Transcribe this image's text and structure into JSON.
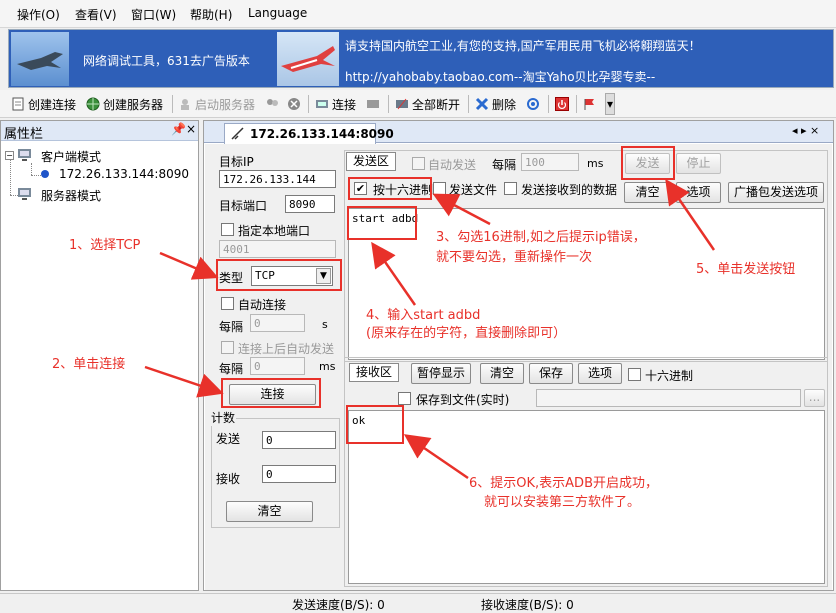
{
  "menu": [
    "操作(O)",
    "查看(V)",
    "窗口(W)",
    "帮助(H)",
    "Language"
  ],
  "banner": {
    "left_text": "网络调试工具，631去广告版本",
    "right_line1": "请支持国内航空工业,有您的支持,国产军用民用飞机必将翱翔蓝天！",
    "right_line2": "http://yahobaby.taobao.com--淘宝Yaho贝比孕婴专卖--"
  },
  "toolbar": {
    "create_conn": "创建连接",
    "create_server": "创建服务器",
    "start_server": "启动服务器",
    "connect": "连接",
    "disconnect_all": "全部断开",
    "delete": "删除"
  },
  "sidebar": {
    "title": "属性栏",
    "pin": "ᵖ",
    "close": "×",
    "client_mode": "客户端模式",
    "connection": "172.26.133.144:8090",
    "server_mode": "服务器模式"
  },
  "doc": {
    "tab_label": "172.26.133.144:8090",
    "nav": "◂ ▸ ×"
  },
  "left_form": {
    "target_ip_label": "目标IP",
    "target_ip": "172.26.133.144",
    "target_port_label": "目标端口",
    "target_port": "8090",
    "local_port_label": "指定本地端口",
    "local_port": "4001",
    "type_label": "类型",
    "type_value": "TCP",
    "auto_connect_label": "自动连接",
    "interval_label": "每隔",
    "interval_value": "0",
    "interval_unit": "s",
    "auto_send_label": "连接上后自动发送",
    "interval2_label": "每隔",
    "interval2_value": "0",
    "interval2_unit": "ms",
    "connect_button": "连接",
    "count_label": "计数",
    "send_label": "发送",
    "send_value": "0",
    "recv_label": "接收",
    "recv_value": "0",
    "clear_button": "清空"
  },
  "send_area": {
    "tab": "发送区",
    "auto_send": "自动发送",
    "every": "每隔",
    "every_value": "100",
    "unit": "ms",
    "send_button": "发送",
    "stop_button": "停止",
    "hex_send": "按十六进制",
    "send_file": "发送文件",
    "send_received": "发送接收到的数据",
    "clear_button": "清空",
    "options_button": "选项",
    "broadcast_button": "广播包发送选项",
    "content": "start adbd"
  },
  "recv_area": {
    "tab": "接收区",
    "pause_button": "暂停显示",
    "clear_button": "清空",
    "save_button": "保存",
    "options_button": "选项",
    "hex_label": "十六进制",
    "save_to_file": "保存到文件(实时)",
    "browse": "...",
    "content": "ok"
  },
  "status": {
    "send_speed": "发送速度(B/S): 0",
    "recv_speed": "接收速度(B/S): 0"
  },
  "annotations": {
    "a1": "1、选择TCP",
    "a2": "2、单击连接",
    "a3_line1": "3、勾选16进制,如之后提示ip错误，",
    "a3_line2": "就不要勾选，重新操作一次",
    "a4_line1": "4、输入start adbd",
    "a4_line2": "(原来存在的字符，直接删除即可）",
    "a5": "5、单击发送按钮",
    "a6_line1": "6、提示OK,表示ADB开启成功，",
    "a6_line2": "就可以安装第三方软件了。"
  },
  "colors": {
    "annotation_red": "#e8312a",
    "banner_blue": "#2e5fb8"
  }
}
